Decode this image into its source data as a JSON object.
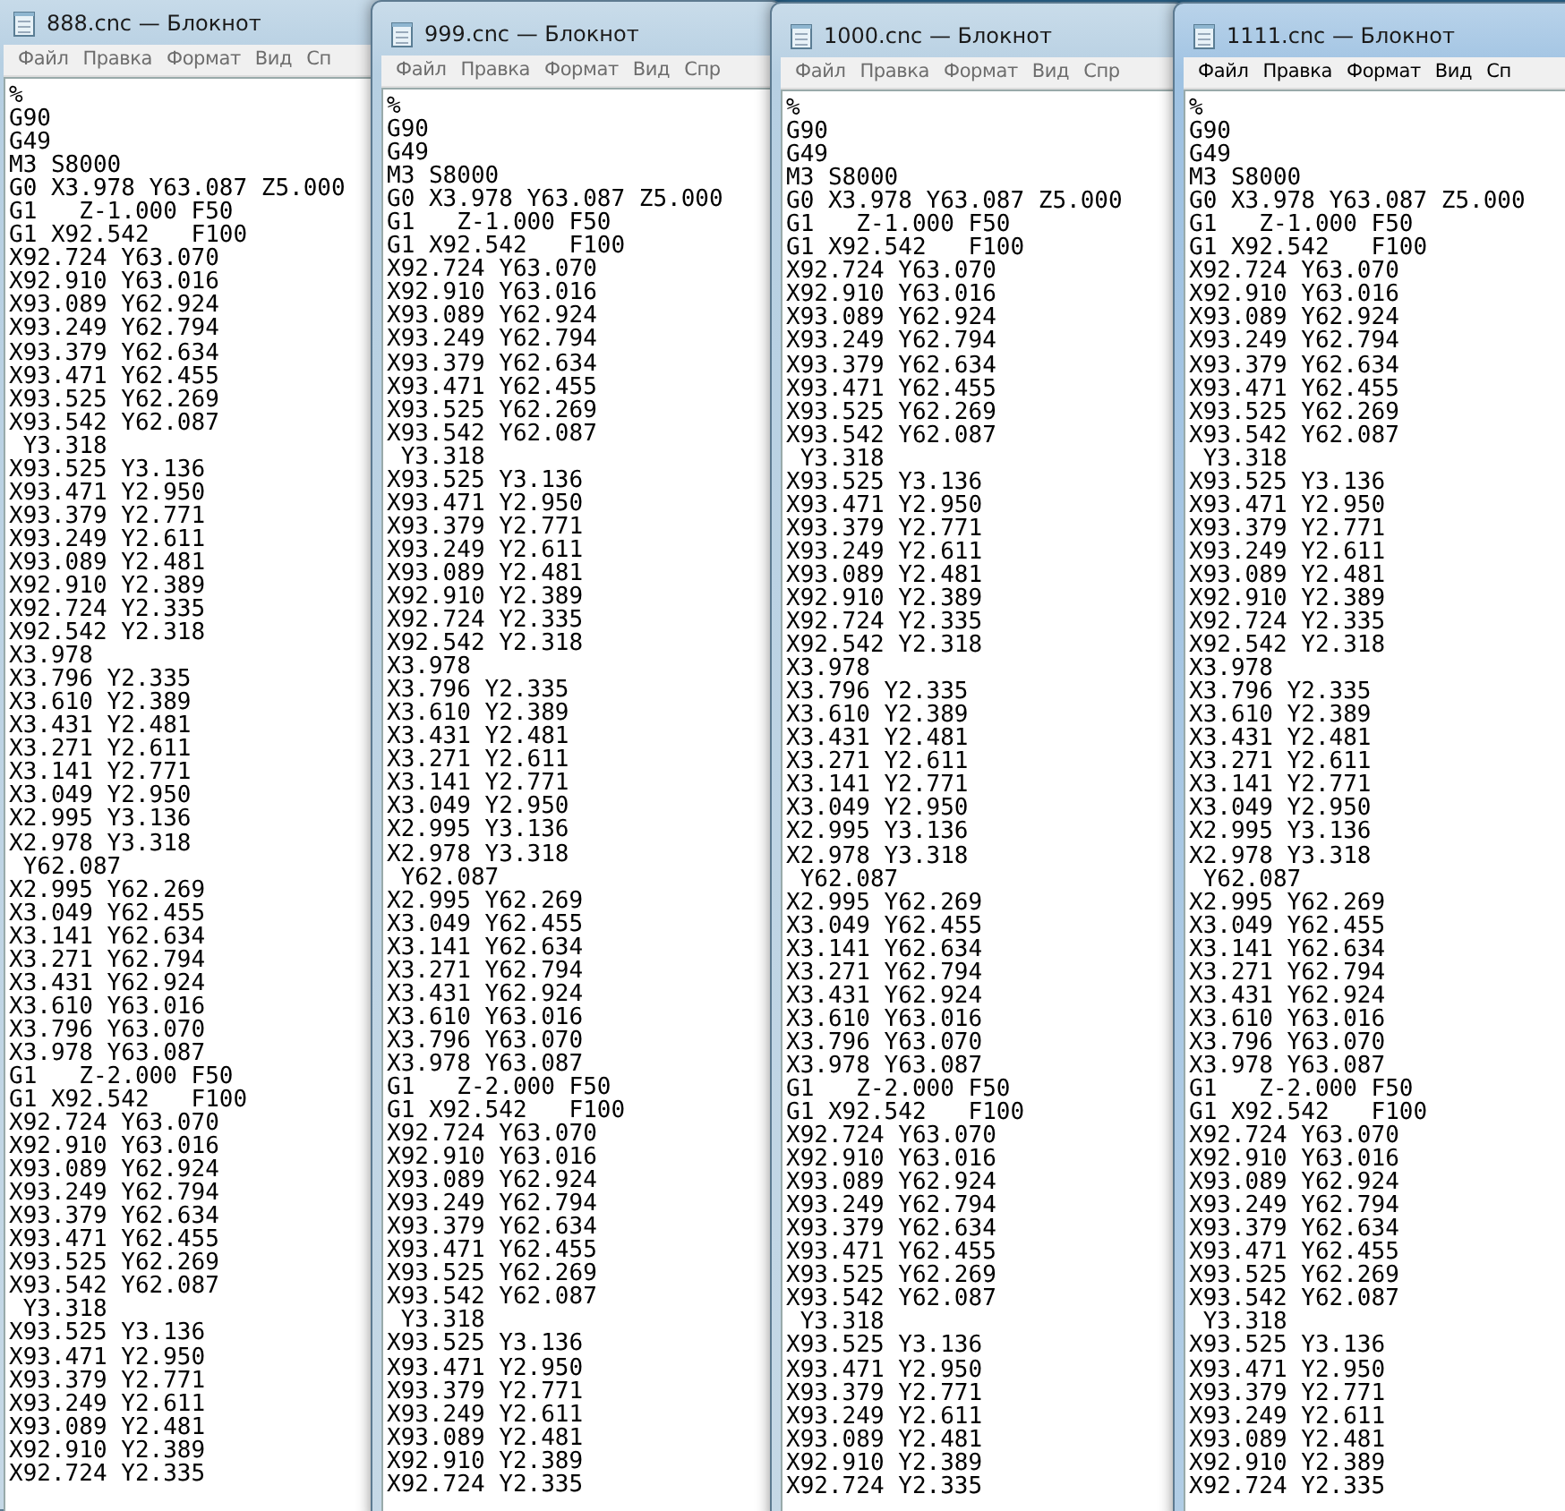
{
  "windows": [
    {
      "title": "888.cnc — Блокнот",
      "active": false,
      "menu": [
        "Файл",
        "Правка",
        "Формат",
        "Вид",
        "Сп"
      ],
      "text": "%\nG90\nG49\nM3 S8000\nG0 X3.978 Y63.087 Z5.000\nG1   Z-1.000 F50\nG1 X92.542   F100\nX92.724 Y63.070\nX92.910 Y63.016\nX93.089 Y62.924\nX93.249 Y62.794\nX93.379 Y62.634\nX93.471 Y62.455\nX93.525 Y62.269\nX93.542 Y62.087\n Y3.318\nX93.525 Y3.136\nX93.471 Y2.950\nX93.379 Y2.771\nX93.249 Y2.611\nX93.089 Y2.481\nX92.910 Y2.389\nX92.724 Y2.335\nX92.542 Y2.318\nX3.978\nX3.796 Y2.335\nX3.610 Y2.389\nX3.431 Y2.481\nX3.271 Y2.611\nX3.141 Y2.771\nX3.049 Y2.950\nX2.995 Y3.136\nX2.978 Y3.318\n Y62.087\nX2.995 Y62.269\nX3.049 Y62.455\nX3.141 Y62.634\nX3.271 Y62.794\nX3.431 Y62.924\nX3.610 Y63.016\nX3.796 Y63.070\nX3.978 Y63.087\nG1   Z-2.000 F50\nG1 X92.542   F100\nX92.724 Y63.070\nX92.910 Y63.016\nX93.089 Y62.924\nX93.249 Y62.794\nX93.379 Y62.634\nX93.471 Y62.455\nX93.525 Y62.269\nX93.542 Y62.087\n Y3.318\nX93.525 Y3.136\nX93.471 Y2.950\nX93.379 Y2.771\nX93.249 Y2.611\nX93.089 Y2.481\nX92.910 Y2.389\nX92.724 Y2.335"
    },
    {
      "title": "999.cnc — Блокнот",
      "active": false,
      "menu": [
        "Файл",
        "Правка",
        "Формат",
        "Вид",
        "Спр"
      ],
      "text": "%\nG90\nG49\nM3 S8000\nG0 X3.978 Y63.087 Z5.000\nG1   Z-1.000 F50\nG1 X92.542   F100\nX92.724 Y63.070\nX92.910 Y63.016\nX93.089 Y62.924\nX93.249 Y62.794\nX93.379 Y62.634\nX93.471 Y62.455\nX93.525 Y62.269\nX93.542 Y62.087\n Y3.318\nX93.525 Y3.136\nX93.471 Y2.950\nX93.379 Y2.771\nX93.249 Y2.611\nX93.089 Y2.481\nX92.910 Y2.389\nX92.724 Y2.335\nX92.542 Y2.318\nX3.978\nX3.796 Y2.335\nX3.610 Y2.389\nX3.431 Y2.481\nX3.271 Y2.611\nX3.141 Y2.771\nX3.049 Y2.950\nX2.995 Y3.136\nX2.978 Y3.318\n Y62.087\nX2.995 Y62.269\nX3.049 Y62.455\nX3.141 Y62.634\nX3.271 Y62.794\nX3.431 Y62.924\nX3.610 Y63.016\nX3.796 Y63.070\nX3.978 Y63.087\nG1   Z-2.000 F50\nG1 X92.542   F100\nX92.724 Y63.070\nX92.910 Y63.016\nX93.089 Y62.924\nX93.249 Y62.794\nX93.379 Y62.634\nX93.471 Y62.455\nX93.525 Y62.269\nX93.542 Y62.087\n Y3.318\nX93.525 Y3.136\nX93.471 Y2.950\nX93.379 Y2.771\nX93.249 Y2.611\nX93.089 Y2.481\nX92.910 Y2.389\nX92.724 Y2.335"
    },
    {
      "title": "1000.cnc — Блокнот",
      "active": false,
      "menu": [
        "Файл",
        "Правка",
        "Формат",
        "Вид",
        "Спр"
      ],
      "text": "%\nG90\nG49\nM3 S8000\nG0 X3.978 Y63.087 Z5.000\nG1   Z-1.000 F50\nG1 X92.542   F100\nX92.724 Y63.070\nX92.910 Y63.016\nX93.089 Y62.924\nX93.249 Y62.794\nX93.379 Y62.634\nX93.471 Y62.455\nX93.525 Y62.269\nX93.542 Y62.087\n Y3.318\nX93.525 Y3.136\nX93.471 Y2.950\nX93.379 Y2.771\nX93.249 Y2.611\nX93.089 Y2.481\nX92.910 Y2.389\nX92.724 Y2.335\nX92.542 Y2.318\nX3.978\nX3.796 Y2.335\nX3.610 Y2.389\nX3.431 Y2.481\nX3.271 Y2.611\nX3.141 Y2.771\nX3.049 Y2.950\nX2.995 Y3.136\nX2.978 Y3.318\n Y62.087\nX2.995 Y62.269\nX3.049 Y62.455\nX3.141 Y62.634\nX3.271 Y62.794\nX3.431 Y62.924\nX3.610 Y63.016\nX3.796 Y63.070\nX3.978 Y63.087\nG1   Z-2.000 F50\nG1 X92.542   F100\nX92.724 Y63.070\nX92.910 Y63.016\nX93.089 Y62.924\nX93.249 Y62.794\nX93.379 Y62.634\nX93.471 Y62.455\nX93.525 Y62.269\nX93.542 Y62.087\n Y3.318\nX93.525 Y3.136\nX93.471 Y2.950\nX93.379 Y2.771\nX93.249 Y2.611\nX93.089 Y2.481\nX92.910 Y2.389\nX92.724 Y2.335"
    },
    {
      "title": "1111.cnc — Блокнот",
      "active": true,
      "menu": [
        "Файл",
        "Правка",
        "Формат",
        "Вид",
        "Сп"
      ],
      "text": "%\nG90\nG49\nM3 S8000\nG0 X3.978 Y63.087 Z5.000\nG1   Z-1.000 F50\nG1 X92.542   F100\nX92.724 Y63.070\nX92.910 Y63.016\nX93.089 Y62.924\nX93.249 Y62.794\nX93.379 Y62.634\nX93.471 Y62.455\nX93.525 Y62.269\nX93.542 Y62.087\n Y3.318\nX93.525 Y3.136\nX93.471 Y2.950\nX93.379 Y2.771\nX93.249 Y2.611\nX93.089 Y2.481\nX92.910 Y2.389\nX92.724 Y2.335\nX92.542 Y2.318\nX3.978\nX3.796 Y2.335\nX3.610 Y2.389\nX3.431 Y2.481\nX3.271 Y2.611\nX3.141 Y2.771\nX3.049 Y2.950\nX2.995 Y3.136\nX2.978 Y3.318\n Y62.087\nX2.995 Y62.269\nX3.049 Y62.455\nX3.141 Y62.634\nX3.271 Y62.794\nX3.431 Y62.924\nX3.610 Y63.016\nX3.796 Y63.070\nX3.978 Y63.087\nG1   Z-2.000 F50\nG1 X92.542   F100\nX92.724 Y63.070\nX92.910 Y63.016\nX93.089 Y62.924\nX93.249 Y62.794\nX93.379 Y62.634\nX93.471 Y62.455\nX93.525 Y62.269\nX93.542 Y62.087\n Y3.318\nX93.525 Y3.136\nX93.471 Y2.950\nX93.379 Y2.771\nX93.249 Y2.611\nX93.089 Y2.481\nX92.910 Y2.389\nX92.724 Y2.335"
    }
  ]
}
